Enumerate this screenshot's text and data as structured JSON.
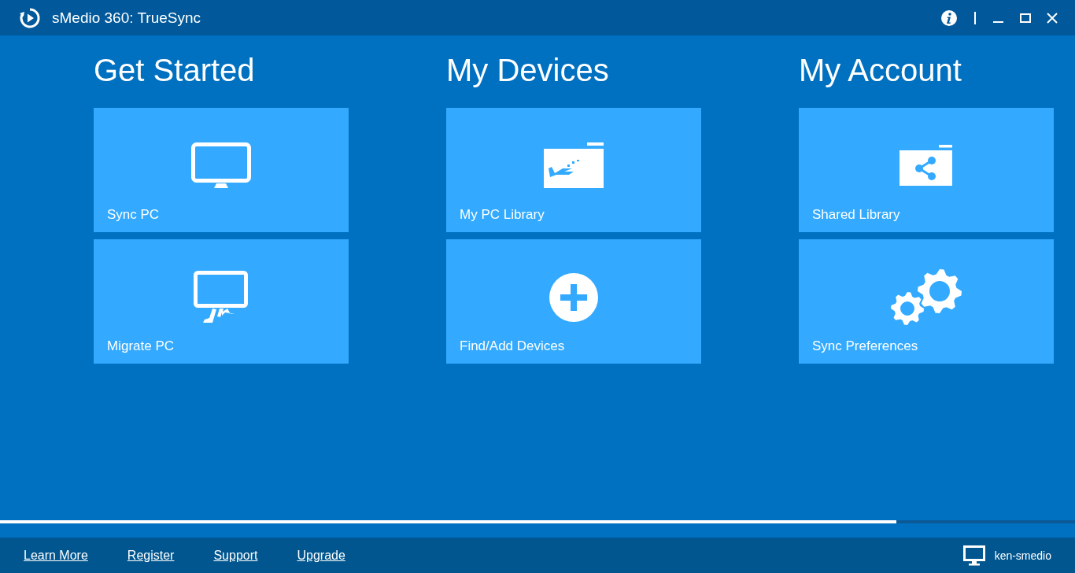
{
  "window": {
    "title": "sMedio 360: TrueSync"
  },
  "sections": [
    {
      "heading": "Get Started",
      "tiles": [
        {
          "label": "Sync PC",
          "kind": "monitor"
        },
        {
          "label": "Migrate PC",
          "kind": "migrate"
        }
      ]
    },
    {
      "heading": "My Devices",
      "tiles": [
        {
          "label": "My PC Library",
          "kind": "library"
        },
        {
          "label": "Find/Add Devices",
          "kind": "add"
        }
      ]
    },
    {
      "heading": "My Account",
      "tiles": [
        {
          "label": "Shared Library",
          "kind": "shared"
        },
        {
          "label": "Sync Preferences",
          "kind": "gears"
        }
      ]
    }
  ],
  "progress": {
    "level": 0.834
  },
  "footer": {
    "links": [
      "Learn More",
      "Register",
      "Support",
      "Upgrade"
    ],
    "computer": "ken-smedio"
  }
}
